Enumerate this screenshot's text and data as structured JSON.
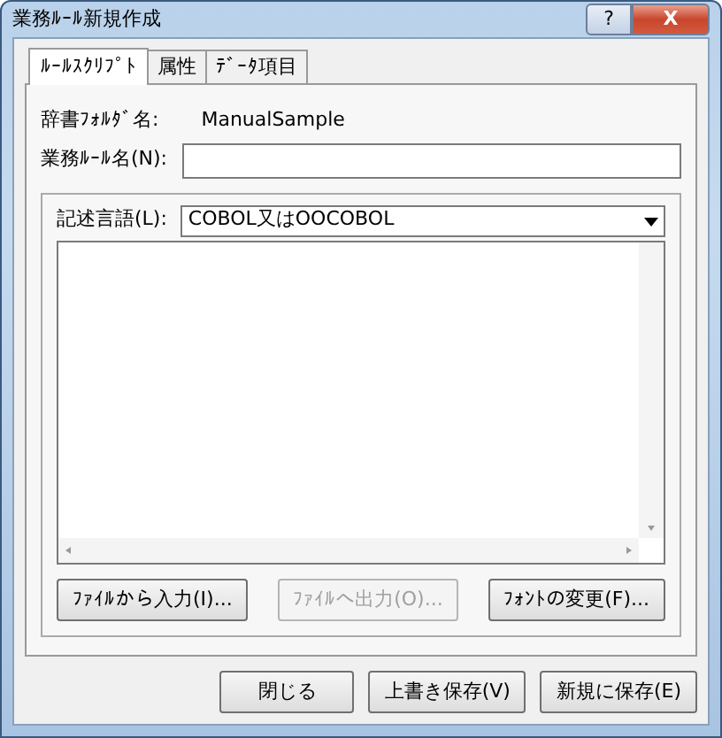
{
  "window": {
    "title": "業務ﾙｰﾙ新規作成",
    "help": "?",
    "close": "X"
  },
  "tabs": [
    {
      "label": "ﾙｰﾙｽｸﾘﾌﾟﾄ",
      "selected": true
    },
    {
      "label": "属性",
      "selected": false
    },
    {
      "label": "ﾃﾞｰﾀ項目",
      "selected": false
    }
  ],
  "dictionary_folder": {
    "label": "辞書ﾌｫﾙﾀﾞ名:",
    "value": "ManualSample"
  },
  "rule_name": {
    "label": "業務ﾙｰﾙ名(N):"
  },
  "language": {
    "label": "記述言語(L):",
    "value": "COBOL又はOOCOBOL"
  },
  "script_buttons": [
    {
      "label": "ﾌｧｲﾙから入力(I)...",
      "disabled": false
    },
    {
      "label": "ﾌｧｲﾙへ出力(O)...",
      "disabled": true
    },
    {
      "label": "ﾌｫﾝﾄの変更(F)...",
      "disabled": false
    }
  ],
  "buttons": [
    {
      "label": "閉じる",
      "disabled": false
    },
    {
      "label": "上書き保存(V)",
      "disabled": false
    },
    {
      "label": "新規に保存(E)",
      "disabled": false
    }
  ]
}
